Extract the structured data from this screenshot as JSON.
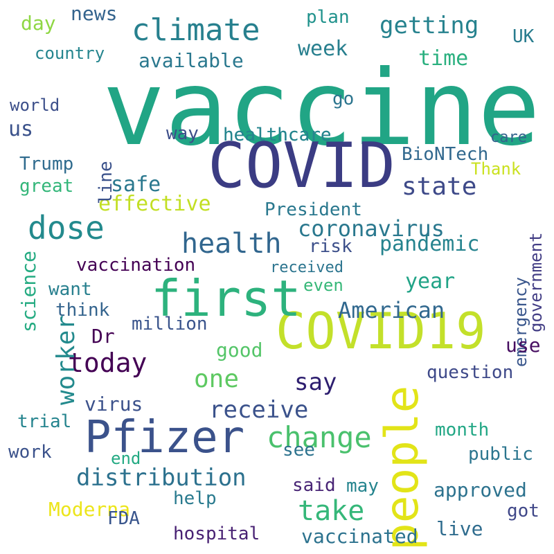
{
  "words": [
    {
      "text": "vaccine",
      "color": "#21a585"
    },
    {
      "text": "COVID",
      "color": "#3b3c83"
    },
    {
      "text": "COVID19",
      "color": "#c3e02a"
    },
    {
      "text": "first",
      "color": "#2db27d"
    },
    {
      "text": "people",
      "color": "#e2e418"
    },
    {
      "text": "Pfizer",
      "color": "#3b528b"
    },
    {
      "text": "climate",
      "color": "#27808e"
    },
    {
      "text": "health",
      "color": "#31668e"
    },
    {
      "text": "dose",
      "color": "#238a8d"
    },
    {
      "text": "change",
      "color": "#4ac16d"
    },
    {
      "text": "coronavirus",
      "color": "#2a788e"
    },
    {
      "text": "today",
      "color": "#440154"
    },
    {
      "text": "distribution",
      "color": "#2c718e"
    },
    {
      "text": "receive",
      "color": "#3b528b"
    },
    {
      "text": "take",
      "color": "#35b779"
    },
    {
      "text": "American",
      "color": "#31688e"
    },
    {
      "text": "state",
      "color": "#3e4a89"
    },
    {
      "text": "one",
      "color": "#5ec962"
    },
    {
      "text": "worker",
      "color": "#238a8d"
    },
    {
      "text": "pandemic",
      "color": "#25838e"
    },
    {
      "text": "effective",
      "color": "#c2df23"
    },
    {
      "text": "safe",
      "color": "#2a788e"
    },
    {
      "text": "week",
      "color": "#277f8e"
    },
    {
      "text": "getting",
      "color": "#26828e"
    },
    {
      "text": "news",
      "color": "#33638d"
    },
    {
      "text": "year",
      "color": "#20a386"
    },
    {
      "text": "Moderna",
      "color": "#ece51b"
    },
    {
      "text": "vaccination",
      "color": "#440154"
    },
    {
      "text": "million",
      "color": "#3a548c"
    },
    {
      "text": "say",
      "color": "#2d1e6f"
    },
    {
      "text": "BioNTech",
      "color": "#31688e"
    },
    {
      "text": "healthcare",
      "color": "#25858e"
    },
    {
      "text": "President",
      "color": "#2a788e"
    },
    {
      "text": "approved",
      "color": "#2c728e"
    },
    {
      "text": "hospital",
      "color": "#482173"
    },
    {
      "text": "vaccinated",
      "color": "#2c728e"
    },
    {
      "text": "available",
      "color": "#2a788e"
    },
    {
      "text": "time",
      "color": "#2ab07f"
    },
    {
      "text": "country",
      "color": "#25858e"
    },
    {
      "text": "Trump",
      "color": "#2f6b8e"
    },
    {
      "text": "great",
      "color": "#33b679"
    },
    {
      "text": "us",
      "color": "#3b528b"
    },
    {
      "text": "month",
      "color": "#22a785"
    },
    {
      "text": "question",
      "color": "#3e4989"
    },
    {
      "text": "public",
      "color": "#2b758e"
    },
    {
      "text": "work",
      "color": "#3b528b"
    },
    {
      "text": "trial",
      "color": "#25848e"
    },
    {
      "text": "virus",
      "color": "#3b518b"
    },
    {
      "text": "FDA",
      "color": "#39558c"
    },
    {
      "text": "live",
      "color": "#2f6c8e"
    },
    {
      "text": "science",
      "color": "#25ab82"
    },
    {
      "text": "emergency",
      "color": "#39568c"
    },
    {
      "text": "government",
      "color": "#433e85"
    },
    {
      "text": "care",
      "color": "#33638d"
    },
    {
      "text": "Thank",
      "color": "#cae11f"
    },
    {
      "text": "way",
      "color": "#3d4e8a"
    },
    {
      "text": "UK",
      "color": "#287c8e"
    },
    {
      "text": "day",
      "color": "#8fd744"
    },
    {
      "text": "plan",
      "color": "#20928c"
    },
    {
      "text": "world",
      "color": "#3c4f8a"
    },
    {
      "text": "go",
      "color": "#2b748e"
    },
    {
      "text": "line",
      "color": "#3b528b"
    },
    {
      "text": "risk",
      "color": "#3c4f8a"
    },
    {
      "text": "received",
      "color": "#2b748e"
    },
    {
      "text": "even",
      "color": "#37b878"
    },
    {
      "text": "want",
      "color": "#277f8e"
    },
    {
      "text": "think",
      "color": "#33638d"
    },
    {
      "text": "Dr",
      "color": "#440154"
    },
    {
      "text": "good",
      "color": "#54c568"
    },
    {
      "text": "use",
      "color": "#470e61"
    },
    {
      "text": "end",
      "color": "#24aa83"
    },
    {
      "text": "help",
      "color": "#297a8e"
    },
    {
      "text": "said",
      "color": "#482475"
    },
    {
      "text": "may",
      "color": "#25848e"
    },
    {
      "text": "see",
      "color": "#2c728e"
    },
    {
      "text": "got",
      "color": "#3f4788"
    },
    {
      "text": "healthcare",
      "color": "#25858e"
    }
  ]
}
